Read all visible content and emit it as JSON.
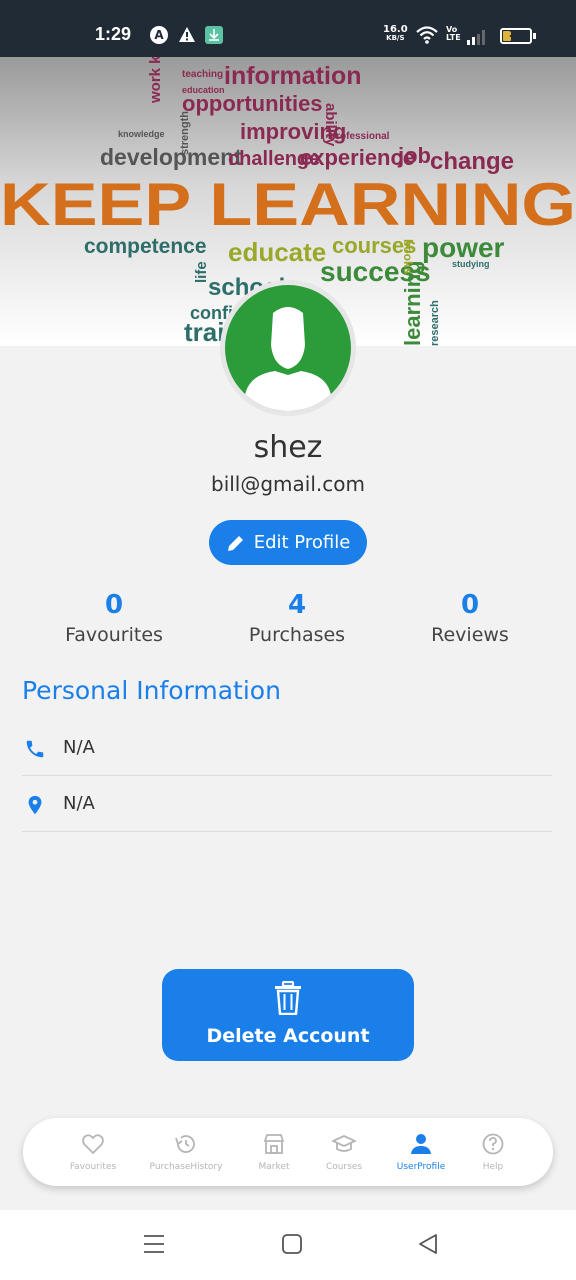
{
  "status_bar": {
    "time": "1:29",
    "net_speed_value": "16.0",
    "net_speed_unit": "KB/S",
    "volte_top": "Vo",
    "volte_bottom": "LTE",
    "battery_level": "27"
  },
  "banner": {
    "headline": "KEEP LEARNING",
    "words": [
      "work know",
      "information",
      "opportunities",
      "improving",
      "development",
      "challenge",
      "experience",
      "job",
      "change",
      "competence",
      "educate",
      "courses",
      "power",
      "success",
      "school",
      "confide",
      "train",
      "learning",
      "research",
      "teaching",
      "education",
      "knowledge",
      "ability",
      "professional",
      "strength",
      "books",
      "studying",
      "life"
    ]
  },
  "profile": {
    "name": "shez",
    "email": "bill@gmail.com",
    "edit_label": "Edit Profile"
  },
  "stats": [
    {
      "value": "0",
      "label": "Favourites"
    },
    {
      "value": "4",
      "label": "Purchases"
    },
    {
      "value": "0",
      "label": "Reviews"
    }
  ],
  "personal_info": {
    "title": "Personal Information",
    "phone": "N/A",
    "location": "N/A"
  },
  "delete_label": "Delete Account",
  "bottom_nav": [
    {
      "label": "Favourites",
      "icon": "heart-icon",
      "active": false
    },
    {
      "label": "PurchaseHistory",
      "icon": "history-icon",
      "active": false
    },
    {
      "label": "Market",
      "icon": "store-icon",
      "active": false
    },
    {
      "label": "Courses",
      "icon": "graduation-cap-icon",
      "active": false
    },
    {
      "label": "UserProfile",
      "icon": "person-icon",
      "active": true
    },
    {
      "label": "Help",
      "icon": "help-icon",
      "active": false
    }
  ],
  "colors": {
    "accent": "#1a7fe8",
    "avatar_bg": "#2c9c3a",
    "status_bar": "#202b35",
    "banner_headline": "#d4701b"
  }
}
